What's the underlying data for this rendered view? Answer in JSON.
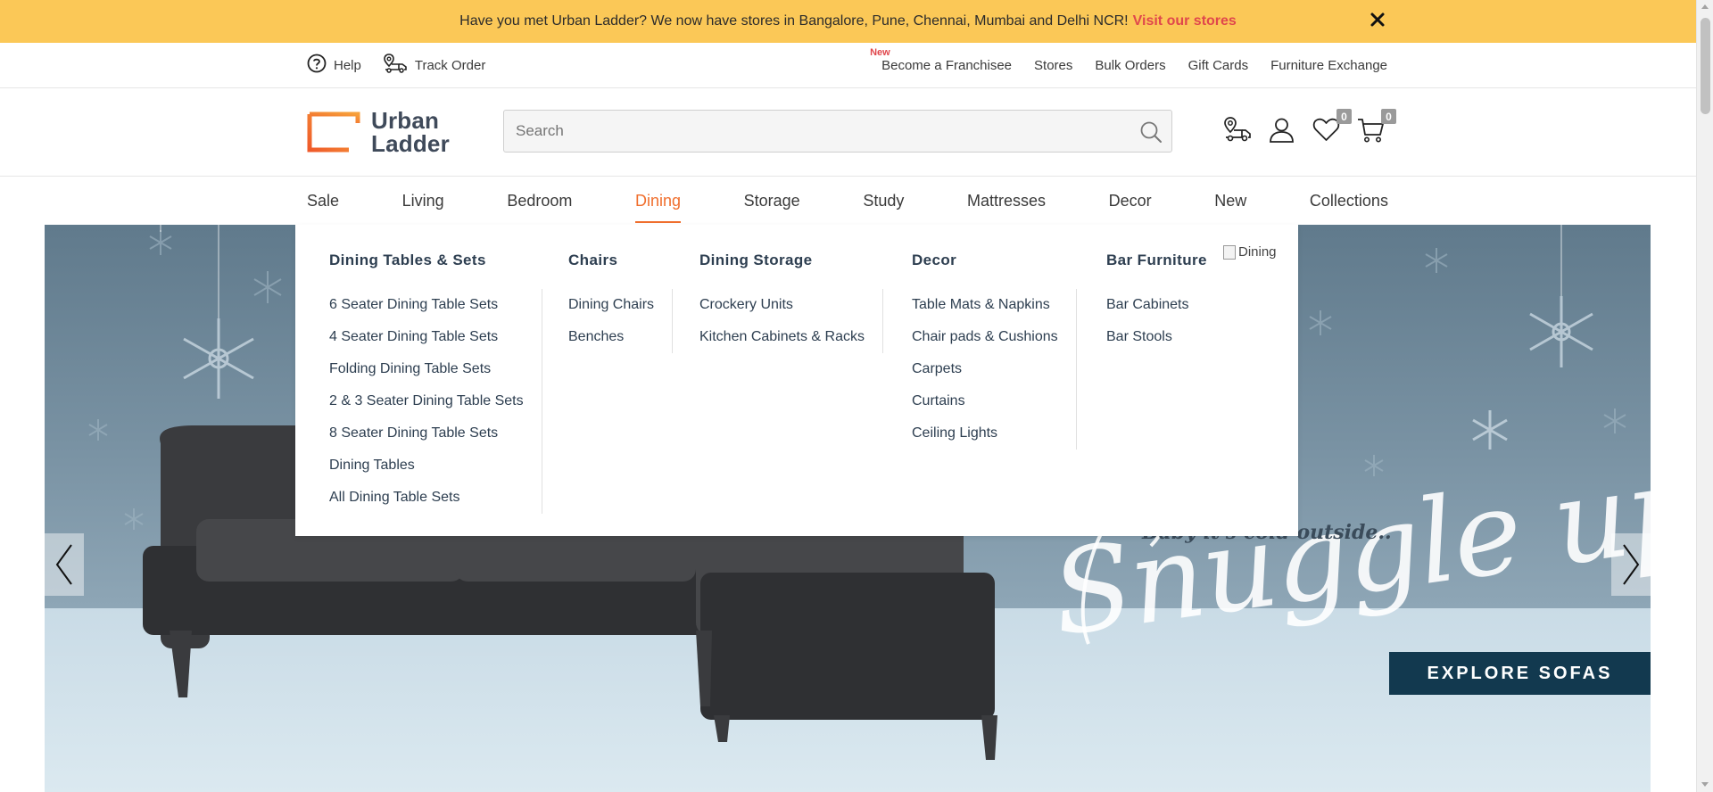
{
  "promo": {
    "text": "Have you met Urban Ladder? We now have stores in Bangalore, Pune, Chennai, Mumbai and Delhi NCR!",
    "link": "Visit our stores",
    "close_icon": "close-icon"
  },
  "util": {
    "help": "Help",
    "track_order": "Track Order",
    "new_tag": "New",
    "links": [
      "Become a Franchisee",
      "Stores",
      "Bulk Orders",
      "Gift Cards",
      "Furniture Exchange"
    ]
  },
  "header": {
    "logo_line1": "Urban",
    "logo_line2": "Ladder",
    "search_placeholder": "Search",
    "wishlist_count": "0",
    "cart_count": "0"
  },
  "nav": {
    "items": [
      "Sale",
      "Living",
      "Bedroom",
      "Dining",
      "Storage",
      "Study",
      "Mattresses",
      "Decor",
      "New",
      "Collections"
    ],
    "active": "Dining"
  },
  "mega": {
    "columns": [
      {
        "title": "Dining Tables & Sets",
        "items": [
          "6 Seater Dining Table Sets",
          "4 Seater Dining Table Sets",
          "Folding Dining Table Sets",
          "2 & 3 Seater Dining Table Sets",
          "8 Seater Dining Table Sets",
          "Dining Tables",
          "All Dining Table Sets"
        ]
      },
      {
        "title": "Chairs",
        "items": [
          "Dining Chairs",
          "Benches"
        ]
      },
      {
        "title": "Dining Storage",
        "items": [
          "Crockery Units",
          "Kitchen Cabinets & Racks"
        ]
      },
      {
        "title": "Decor",
        "items": [
          "Table Mats & Napkins",
          "Chair pads & Cushions",
          "Carpets",
          "Curtains",
          "Ceiling Lights"
        ]
      },
      {
        "title": "Bar Furniture",
        "items": [
          "Bar Cabinets",
          "Bar Stools"
        ]
      }
    ],
    "image_alt": "Dining"
  },
  "hero": {
    "subtitle": "Baby it's cold outside..",
    "script": "Snuggle up",
    "cta": "EXPLORE SOFAS"
  },
  "colors": {
    "promo_bg": "#fbc857",
    "accent": "#f06f2e",
    "link_red": "#e0474c",
    "navy": "#12394f"
  }
}
